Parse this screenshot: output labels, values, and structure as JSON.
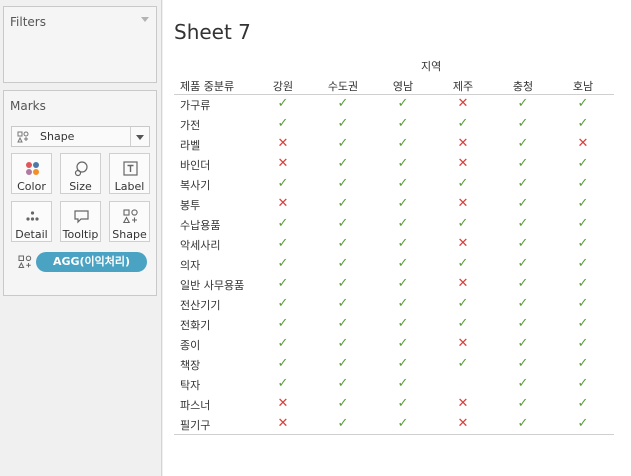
{
  "left_panel": {
    "filters_title": "Filters",
    "marks_title": "Marks",
    "mark_type": "Shape",
    "buttons": {
      "color": "Color",
      "size": "Size",
      "label": "Label",
      "detail": "Detail",
      "tooltip": "Tooltip",
      "shape": "Shape"
    },
    "shape_pill": "AGG(이익처리)"
  },
  "sheet": {
    "title": "Sheet 7",
    "column_group_title": "지역",
    "row_header": "제품 중분류",
    "columns": [
      "강원",
      "수도권",
      "영남",
      "제주",
      "충청",
      "호남"
    ],
    "rows": [
      {
        "label": "가구류",
        "marks": [
          "ok",
          "ok",
          "ok",
          "no",
          "ok",
          "ok"
        ]
      },
      {
        "label": "가전",
        "marks": [
          "ok",
          "ok",
          "ok",
          "ok",
          "ok",
          "ok"
        ]
      },
      {
        "label": "라벨",
        "marks": [
          "no",
          "ok",
          "ok",
          "no",
          "ok",
          "no"
        ]
      },
      {
        "label": "바인더",
        "marks": [
          "no",
          "ok",
          "ok",
          "no",
          "ok",
          "ok"
        ]
      },
      {
        "label": "복사기",
        "marks": [
          "ok",
          "ok",
          "ok",
          "ok",
          "ok",
          "ok"
        ]
      },
      {
        "label": "봉투",
        "marks": [
          "no",
          "ok",
          "ok",
          "no",
          "ok",
          "ok"
        ]
      },
      {
        "label": "수납용품",
        "marks": [
          "ok",
          "ok",
          "ok",
          "ok",
          "ok",
          "ok"
        ]
      },
      {
        "label": "악세사리",
        "marks": [
          "ok",
          "ok",
          "ok",
          "no",
          "ok",
          "ok"
        ]
      },
      {
        "label": "의자",
        "marks": [
          "ok",
          "ok",
          "ok",
          "ok",
          "ok",
          "ok"
        ]
      },
      {
        "label": "일반 사무용품",
        "marks": [
          "ok",
          "ok",
          "ok",
          "no",
          "ok",
          "ok"
        ]
      },
      {
        "label": "전산기기",
        "marks": [
          "ok",
          "ok",
          "ok",
          "ok",
          "ok",
          "ok"
        ]
      },
      {
        "label": "전화기",
        "marks": [
          "ok",
          "ok",
          "ok",
          "ok",
          "ok",
          "ok"
        ]
      },
      {
        "label": "종이",
        "marks": [
          "ok",
          "ok",
          "ok",
          "no",
          "ok",
          "ok"
        ]
      },
      {
        "label": "책장",
        "marks": [
          "ok",
          "ok",
          "ok",
          "ok",
          "ok",
          "ok"
        ]
      },
      {
        "label": "탁자",
        "marks": [
          "ok",
          "ok",
          "ok",
          "",
          "ok",
          "ok"
        ]
      },
      {
        "label": "파스너",
        "marks": [
          "no",
          "ok",
          "ok",
          "no",
          "ok",
          "ok"
        ]
      },
      {
        "label": "필기구",
        "marks": [
          "no",
          "ok",
          "ok",
          "no",
          "ok",
          "ok"
        ]
      }
    ],
    "glyphs": {
      "ok": "✓",
      "no": "✕"
    },
    "colors": {
      "ok": "#5b9a3b",
      "no": "#d6403c",
      "pill": "#4aa3c3"
    }
  }
}
